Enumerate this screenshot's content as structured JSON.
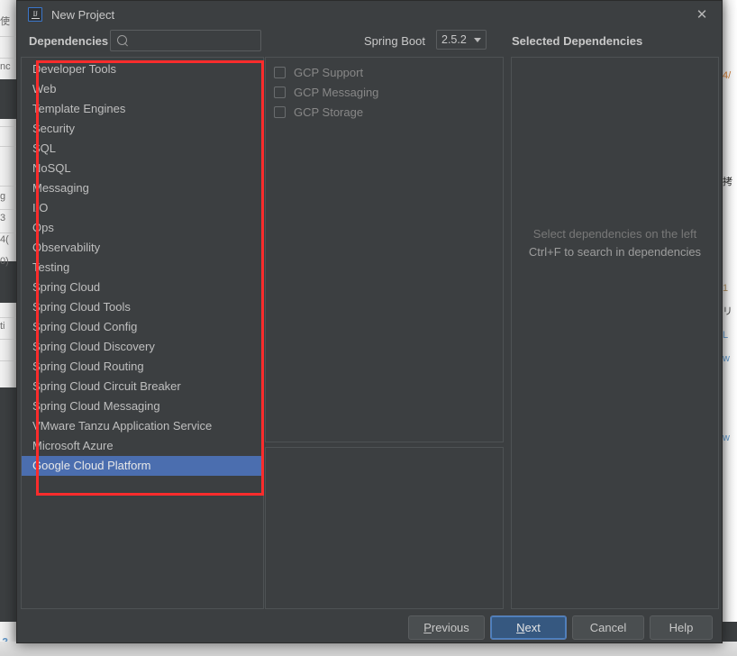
{
  "window": {
    "title": "New Project",
    "app_icon": "intellij-idea-icon",
    "close_icon": "close-icon"
  },
  "header": {
    "dependencies_label": "Dependencies",
    "search": {
      "value": "",
      "placeholder": "",
      "icon": "search-icon"
    },
    "spring_boot_label": "Spring Boot",
    "spring_boot_version": "2.5.2",
    "spring_boot_options": [
      "2.5.2"
    ],
    "selected_dependencies_label": "Selected Dependencies"
  },
  "categories": {
    "selected": "Google Cloud Platform",
    "items": [
      "Developer Tools",
      "Web",
      "Template Engines",
      "Security",
      "SQL",
      "NoSQL",
      "Messaging",
      "I/O",
      "Ops",
      "Observability",
      "Testing",
      "Spring Cloud",
      "Spring Cloud Tools",
      "Spring Cloud Config",
      "Spring Cloud Discovery",
      "Spring Cloud Routing",
      "Spring Cloud Circuit Breaker",
      "Spring Cloud Messaging",
      "VMware Tanzu Application Service",
      "Microsoft Azure",
      "Google Cloud Platform"
    ]
  },
  "dependencies": {
    "items": [
      {
        "label": "GCP Support",
        "checked": false
      },
      {
        "label": "GCP Messaging",
        "checked": false
      },
      {
        "label": "GCP Storage",
        "checked": false
      }
    ]
  },
  "description": {
    "text": ""
  },
  "selected_panel": {
    "empty_line1": "Select dependencies on the left",
    "empty_line2": "Ctrl+F to search in dependencies"
  },
  "buttons": {
    "previous": "Previous",
    "previous_mnemonic": "P",
    "next": "Next",
    "next_mnemonic": "N",
    "cancel": "Cancel",
    "help": "Help"
  },
  "annotation": {
    "color": "#fb2c2c",
    "shape": "rectangle",
    "target": "category-list"
  },
  "colors": {
    "dialog_bg": "#3c3f41",
    "selection_blue": "#4b6eaf",
    "primary_button": "#365880",
    "annotation_red": "#fb2c2c",
    "text": "#c8c8c8"
  },
  "background": {
    "gutter_number": "2",
    "left_glyphs": [
      "使",
      "nc",
      "g",
      "3",
      "4(",
      "0)",
      "ti"
    ],
    "right_glyphs": [
      "4/",
      "拷",
      "1",
      "リ",
      "L",
      "w",
      "w"
    ]
  }
}
